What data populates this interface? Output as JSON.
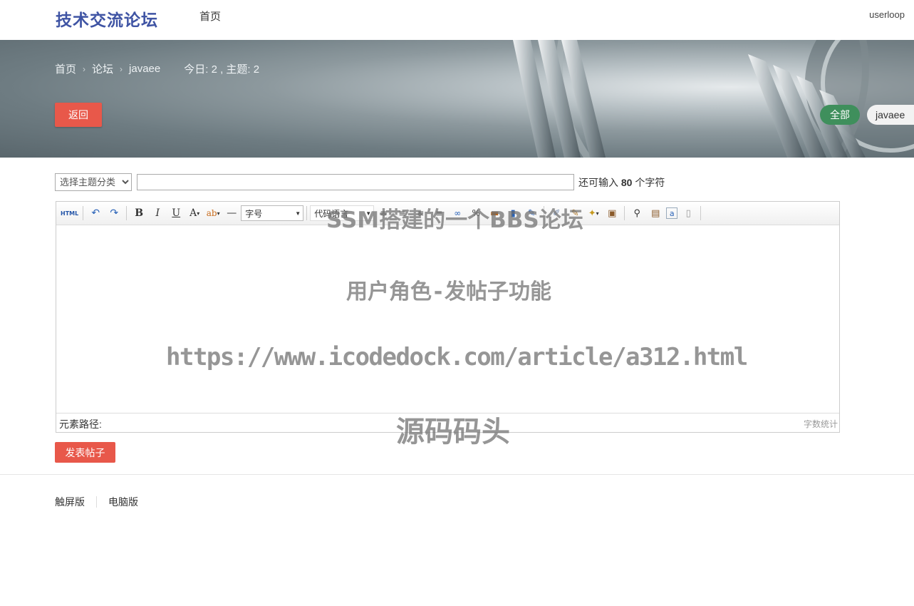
{
  "header": {
    "logo": "技术交流论坛",
    "nav_home": "首页",
    "username": "userloop"
  },
  "banner": {
    "breadcrumbs": [
      "首页",
      "论坛",
      "javaee"
    ],
    "stats": "今日: 2 , 主题: 2",
    "back_label": "返回",
    "tags": [
      "全部",
      "javaee"
    ]
  },
  "form": {
    "topic_select": "选择主题分类",
    "title_value": "",
    "remain_prefix": "还可输入",
    "remain_count": "80",
    "remain_suffix": "个字符"
  },
  "editor": {
    "toolbar": {
      "html": "HTML",
      "font_size": "字号",
      "code_lang": "代码语言"
    },
    "path_label": "元素路径:",
    "word_count": "字数统计"
  },
  "submit_label": "发表帖子",
  "footer": {
    "touch": "触屏版",
    "pc": "电脑版"
  },
  "watermark": {
    "line1": "SSM搭建的一个BBS论坛",
    "line2": "用户角色-发帖子功能",
    "line3": "https://www.icodedock.com/article/a312.html",
    "line4": "源码码头"
  },
  "colors": {
    "accent_red": "#e8584a",
    "tag_green": "#3f8f5c",
    "logo_blue": "#3f54a4"
  }
}
